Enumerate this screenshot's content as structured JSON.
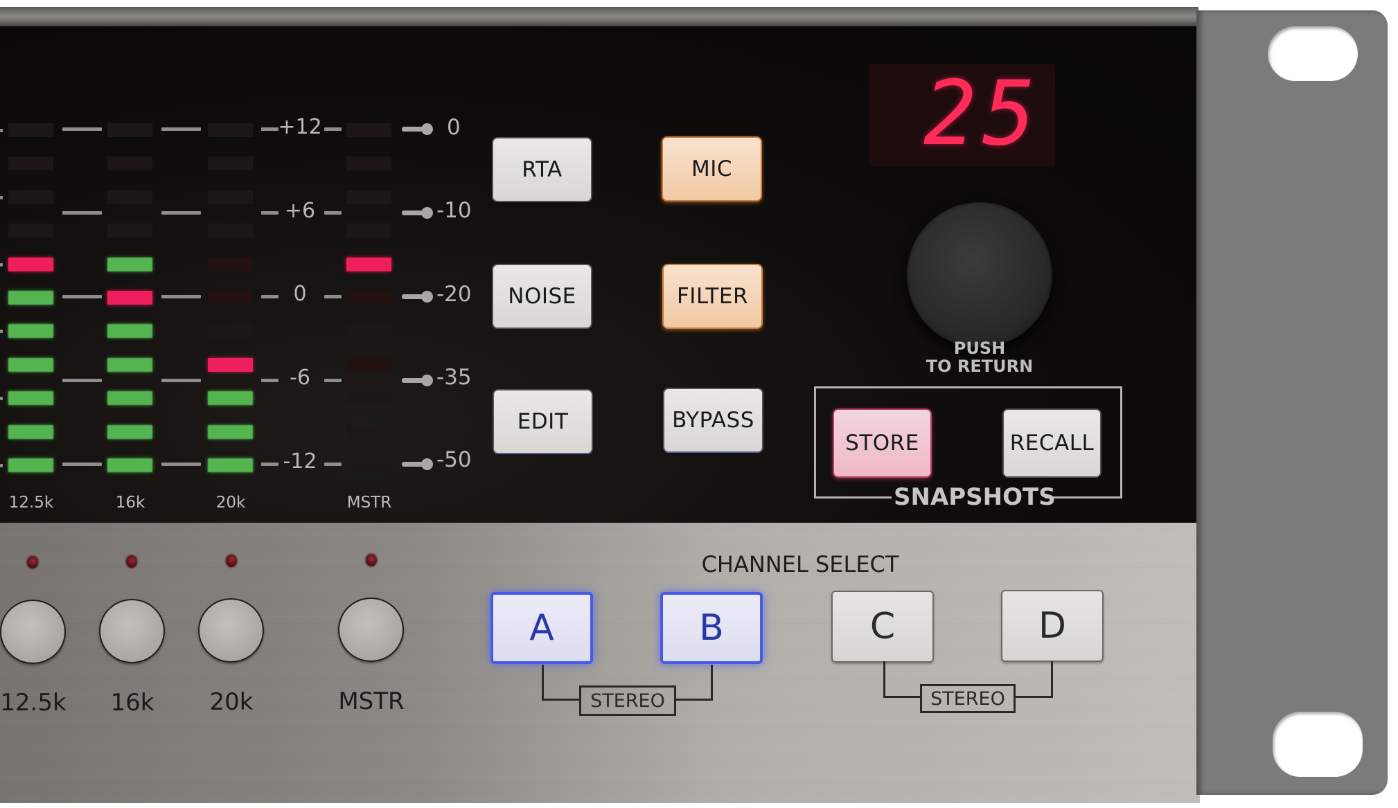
{
  "device": {
    "display_value": "25",
    "knob_label_line1": "PUSH",
    "knob_label_line2": "TO RETURN",
    "snapshots_label": "SNAPSHOTS",
    "channel_select_label": "CHANNEL SELECT"
  },
  "meter": {
    "scale_left": [
      "+12",
      "+6",
      "0",
      "-6",
      "-12"
    ],
    "scale_right": [
      "0",
      "-10",
      "-20",
      "-35",
      "-50"
    ],
    "rows": 11,
    "bands": [
      {
        "label": "12.5k",
        "states": [
          "off",
          "off",
          "off",
          "off",
          "red",
          "green",
          "green",
          "green",
          "green",
          "green",
          "green"
        ]
      },
      {
        "label": "16k",
        "states": [
          "off",
          "off",
          "off",
          "off",
          "green",
          "red",
          "green",
          "green",
          "green",
          "green",
          "green"
        ]
      },
      {
        "label": "20k",
        "states": [
          "off",
          "off",
          "off",
          "off",
          "off-red",
          "off-red",
          "off",
          "red",
          "green",
          "green",
          "green"
        ]
      },
      {
        "label": "MSTR",
        "states": [
          "off",
          "off",
          "off",
          "off",
          "red",
          "off-red",
          "off",
          "off-red",
          "off",
          "off",
          "off"
        ]
      }
    ]
  },
  "function_buttons": [
    {
      "label": "RTA",
      "lit": "none"
    },
    {
      "label": "MIC",
      "lit": "orange"
    },
    {
      "label": "NOISE",
      "lit": "none"
    },
    {
      "label": "FILTER",
      "lit": "orange"
    },
    {
      "label": "EDIT",
      "lit": "none"
    },
    {
      "label": "BYPASS",
      "lit": "none"
    }
  ],
  "snapshot_buttons": [
    {
      "label": "STORE",
      "lit": "pink"
    },
    {
      "label": "RECALL",
      "lit": "none"
    }
  ],
  "band_buttons": [
    {
      "label": "12.5k"
    },
    {
      "label": "16k"
    },
    {
      "label": "20k"
    },
    {
      "label": "MSTR"
    }
  ],
  "channel_buttons": [
    {
      "label": "A",
      "active": true
    },
    {
      "label": "B",
      "active": true
    },
    {
      "label": "C",
      "active": false
    },
    {
      "label": "D",
      "active": false
    }
  ],
  "stereo_links": [
    {
      "label": "STEREO",
      "channels": [
        "A",
        "B"
      ]
    },
    {
      "label": "STEREO",
      "channels": [
        "C",
        "D"
      ]
    }
  ],
  "colors": {
    "led_green": "#54b44f",
    "led_red": "#ee1f5c",
    "display_red": "#ff2c5a",
    "channel_active_blue": "#4a5ae8",
    "button_orange": "#f2c9a4",
    "button_pink": "#f0b8c5"
  }
}
